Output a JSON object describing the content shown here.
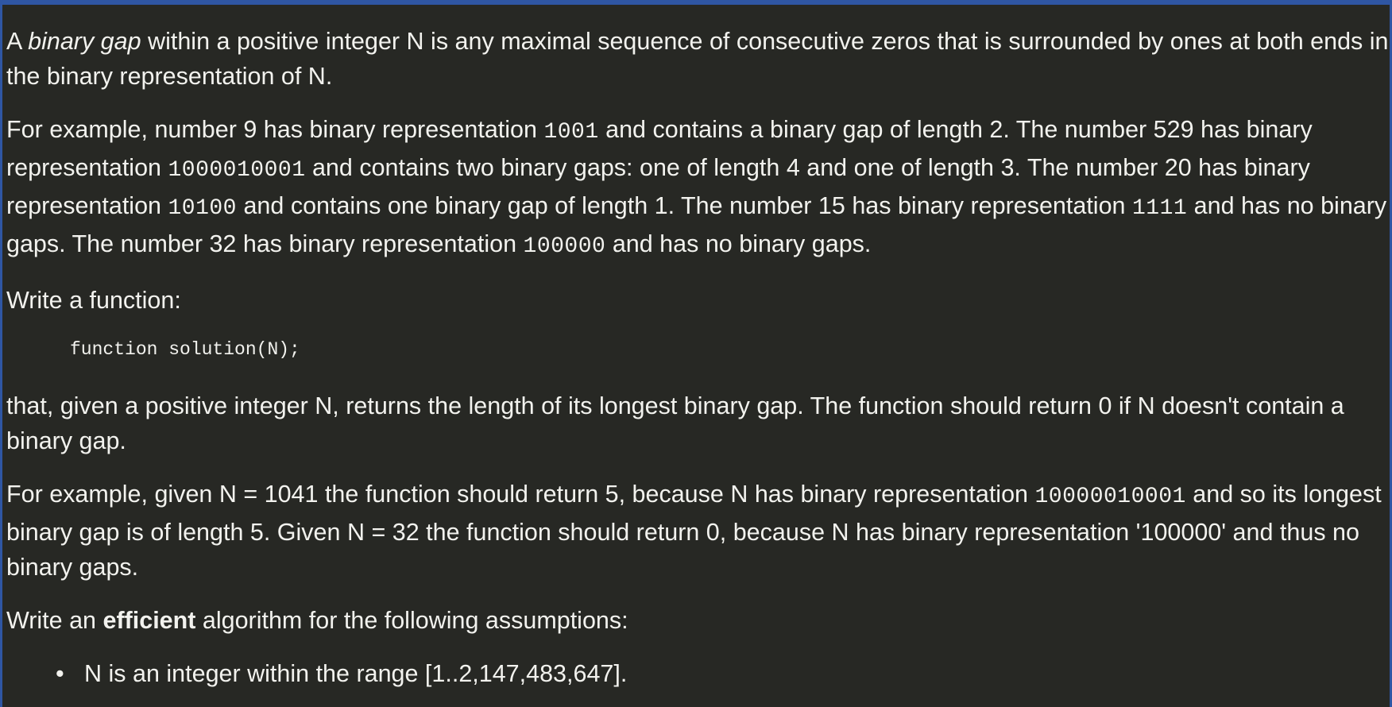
{
  "p1": {
    "before": "A ",
    "em": "binary gap",
    "after": " within a positive integer N is any maximal sequence of consecutive zeros that is surrounded by ones at both ends in the binary representation of N."
  },
  "p2": {
    "t1": "For example, number 9 has binary representation ",
    "c1": "1001",
    "t2": " and contains a binary gap of length 2. The number 529 has binary representation ",
    "c2": "1000010001",
    "t3": " and contains two binary gaps: one of length 4 and one of length 3. The number 20 has binary representation ",
    "c3": "10100",
    "t4": " and contains one binary gap of length 1. The number 15 has binary representation ",
    "c4": "1111",
    "t5": " and has no binary gaps. The number 32 has binary representation ",
    "c5": "100000",
    "t6": " and has no binary gaps."
  },
  "p3": "Write a function:",
  "code": "function solution(N);",
  "p4": "that, given a positive integer N, returns the length of its longest binary gap. The function should return 0 if N doesn't contain a binary gap.",
  "p5": {
    "t1": "For example, given N = 1041 the function should return 5, because N has binary representation ",
    "c1": "10000010001",
    "t2": " and so its longest binary gap is of length 5. Given N = 32 the function should return 0, because N has binary representation '100000' and thus no binary gaps."
  },
  "p6": {
    "before": "Write an ",
    "strong": "efficient",
    "after": " algorithm for the following assumptions:"
  },
  "assumptions": [
    {
      "bullet": "•",
      "text": "N is an integer within the range [1..2,147,483,647]."
    }
  ]
}
